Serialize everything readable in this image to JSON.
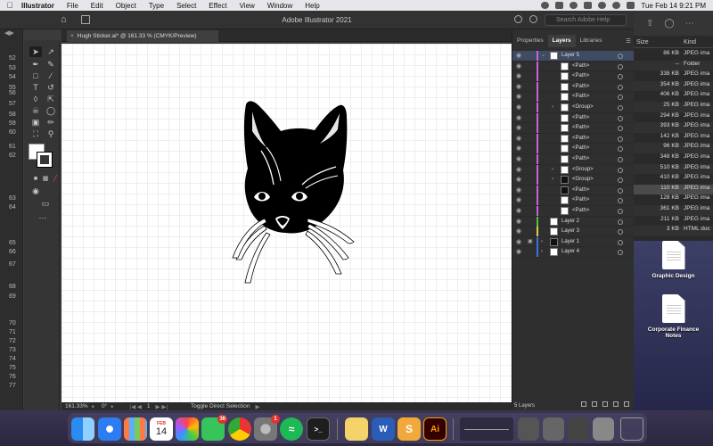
{
  "menubar": {
    "app_name": "Illustrator",
    "items": [
      "File",
      "Edit",
      "Object",
      "Type",
      "Select",
      "Effect",
      "View",
      "Window",
      "Help"
    ],
    "clock": "Tue Feb 14  9:21 PM"
  },
  "appbar": {
    "title": "Adobe Illustrator 2021",
    "search_placeholder": "Search Adobe Help"
  },
  "document_tab": {
    "label": "Hugh Sticker.ai* @ 161.33 % (CMYK/Preview)",
    "close": "×"
  },
  "ruler_numbers": [
    "52",
    "53",
    "54",
    "55",
    "56",
    "57",
    "58",
    "59",
    "60",
    "61",
    "62",
    "63",
    "64",
    "65",
    "66",
    "67",
    "68",
    "69",
    "70",
    "71",
    "72",
    "73",
    "74",
    "75",
    "76",
    "77"
  ],
  "statusbar": {
    "zoom": "161.33%",
    "rotation": "0°",
    "artboard": "1",
    "tool_hint": "Toggle Direct Selection"
  },
  "panel": {
    "tabs": [
      "Properties",
      "Layers",
      "Libraries"
    ],
    "active_tab": "Layers",
    "layers": [
      {
        "name": "Layer 5",
        "level": 0,
        "expanded": true,
        "color": "#c862d6",
        "selected": true
      },
      {
        "name": "<Path>",
        "level": 1,
        "color": "#c862d6"
      },
      {
        "name": "<Path>",
        "level": 1,
        "color": "#c862d6"
      },
      {
        "name": "<Path>",
        "level": 1,
        "color": "#c862d6"
      },
      {
        "name": "<Path>",
        "level": 1,
        "color": "#c862d6"
      },
      {
        "name": "<Group>",
        "level": 1,
        "collapsible": true,
        "color": "#c862d6"
      },
      {
        "name": "<Path>",
        "level": 1,
        "color": "#c862d6"
      },
      {
        "name": "<Path>",
        "level": 1,
        "color": "#c862d6"
      },
      {
        "name": "<Path>",
        "level": 1,
        "color": "#c862d6"
      },
      {
        "name": "<Path>",
        "level": 1,
        "color": "#c862d6"
      },
      {
        "name": "<Path>",
        "level": 1,
        "color": "#c862d6"
      },
      {
        "name": "<Group>",
        "level": 1,
        "collapsible": true,
        "color": "#c862d6"
      },
      {
        "name": "<Group>",
        "level": 1,
        "collapsible": true,
        "color": "#c862d6",
        "dark_thumb": true
      },
      {
        "name": "<Path>",
        "level": 1,
        "color": "#c862d6",
        "dark_thumb": true
      },
      {
        "name": "<Path>",
        "level": 1,
        "color": "#c862d6"
      },
      {
        "name": "<Path>",
        "level": 1,
        "color": "#c862d6"
      },
      {
        "name": "Layer 2",
        "level": 0,
        "color": "#55c23a"
      },
      {
        "name": "Layer 3",
        "level": 0,
        "color": "#d6d14d"
      },
      {
        "name": "Layer 1",
        "level": 0,
        "collapsible": true,
        "locked": true,
        "color": "#3f70e0",
        "dark_thumb": true
      },
      {
        "name": "Layer 4",
        "level": 0,
        "collapsible": true,
        "color": "#3f70e0"
      }
    ],
    "layer_count": "5 Layers"
  },
  "finder": {
    "columns": {
      "size": "Size",
      "kind": "Kind"
    },
    "rows": [
      {
        "size": "86 KB",
        "kind": "JPEG ima"
      },
      {
        "size": "--",
        "kind": "Folder"
      },
      {
        "size": "338 KB",
        "kind": "JPEG ima"
      },
      {
        "size": "354 KB",
        "kind": "JPEG ima"
      },
      {
        "size": "406 KB",
        "kind": "JPEG ima"
      },
      {
        "size": "25 KB",
        "kind": "JPEG ima"
      },
      {
        "size": "294 KB",
        "kind": "JPEG ima"
      },
      {
        "size": "393 KB",
        "kind": "JPEG ima"
      },
      {
        "size": "142 KB",
        "kind": "JPEG ima"
      },
      {
        "size": "96 KB",
        "kind": "JPEG ima"
      },
      {
        "size": "348 KB",
        "kind": "JPEG ima"
      },
      {
        "size": "510 KB",
        "kind": "JPEG ima"
      },
      {
        "size": "410 KB",
        "kind": "JPEG ima"
      },
      {
        "size": "110 KB",
        "kind": "JPEG ima"
      },
      {
        "size": "128 KB",
        "kind": "JPEG ima"
      },
      {
        "size": "361 KB",
        "kind": "JPEG ima"
      },
      {
        "size": "211 KB",
        "kind": "JPEG ima"
      },
      {
        "size": "3 KB",
        "kind": "HTML doc"
      }
    ]
  },
  "desktop_icons": [
    "Graphic Design",
    "Corporate Finance Notes"
  ],
  "dock": {
    "calendar_month": "FEB",
    "calendar_day": "14",
    "messages_badge": "36",
    "settings_badge": "1",
    "illustrator_label": "Ai",
    "word_label": "W",
    "terminal_label": ">_"
  },
  "colors": {
    "layer_selected": "#3f4b63",
    "dock_badge": "#e0322d",
    "canvas": "#ffffff"
  }
}
